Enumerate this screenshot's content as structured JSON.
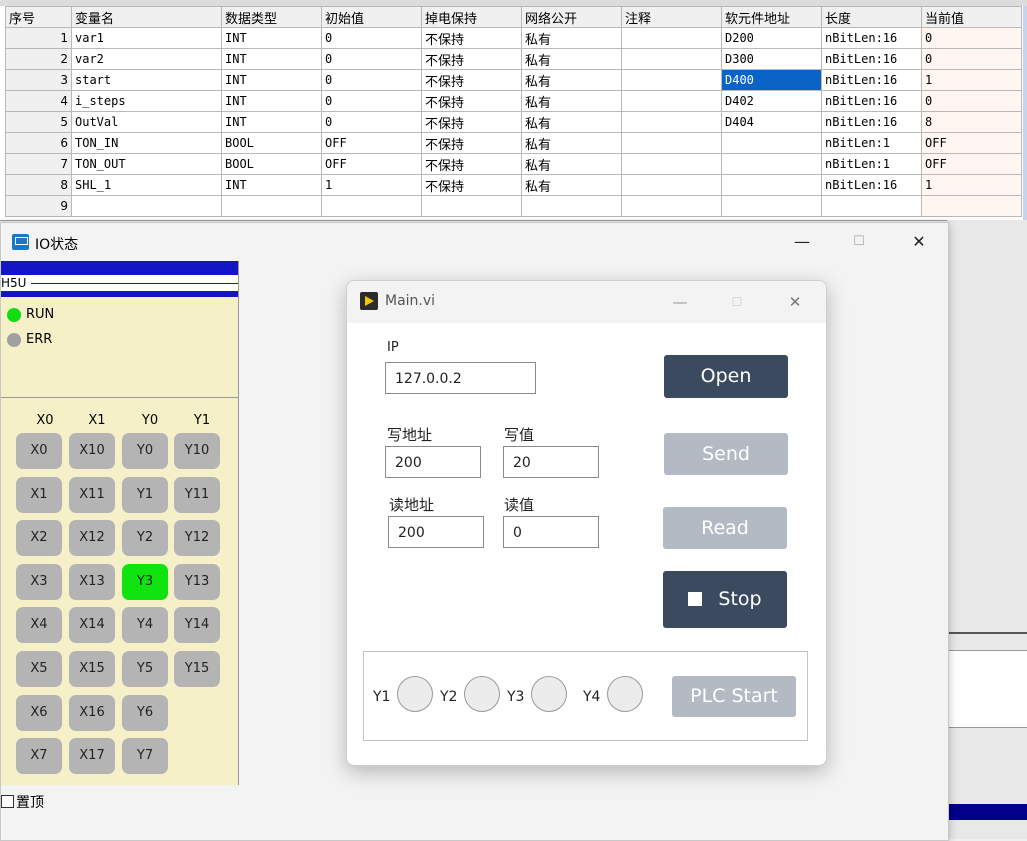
{
  "var_table": {
    "headers": [
      "序号",
      "变量名",
      "数据类型",
      "初始值",
      "掉电保持",
      "网络公开",
      "注释",
      "软元件地址",
      "长度",
      "当前值"
    ],
    "rows": [
      [
        "1",
        "var1",
        "INT",
        "0",
        "不保持",
        "私有",
        "",
        "D200",
        "nBitLen:16",
        "0"
      ],
      [
        "2",
        "var2",
        "INT",
        "0",
        "不保持",
        "私有",
        "",
        "D300",
        "nBitLen:16",
        "0"
      ],
      [
        "3",
        "start",
        "INT",
        "0",
        "不保持",
        "私有",
        "",
        "D400",
        "nBitLen:16",
        "1"
      ],
      [
        "4",
        "i_steps",
        "INT",
        "0",
        "不保持",
        "私有",
        "",
        "D402",
        "nBitLen:16",
        "0"
      ],
      [
        "5",
        "OutVal",
        "INT",
        "0",
        "不保持",
        "私有",
        "",
        "D404",
        "nBitLen:16",
        "8"
      ],
      [
        "6",
        "TON_IN",
        "BOOL",
        "OFF",
        "不保持",
        "私有",
        "",
        "",
        "nBitLen:1",
        "OFF"
      ],
      [
        "7",
        "TON_OUT",
        "BOOL",
        "OFF",
        "不保持",
        "私有",
        "",
        "",
        "nBitLen:1",
        "OFF"
      ],
      [
        "8",
        "SHL_1",
        "INT",
        "1",
        "不保持",
        "私有",
        "",
        "",
        "nBitLen:16",
        "1"
      ],
      [
        "9",
        "",
        "",
        "",
        "",
        "",
        "",
        "",
        "",
        ""
      ]
    ],
    "selected_cell": {
      "row": 3,
      "column": "软元件地址"
    }
  },
  "io_window": {
    "title": "IO状态",
    "window_buttons": {
      "minimize": "—",
      "maximize": "☐",
      "close": "✕"
    },
    "plc_model": "H5U",
    "leds": [
      {
        "label": "RUN",
        "color": "#11dd11"
      },
      {
        "label": "ERR",
        "color": "#a0a0a0"
      }
    ],
    "column_headers": [
      "X0",
      "X1",
      "Y0",
      "Y1"
    ],
    "io_buttons": [
      [
        "X0",
        "X10",
        "Y0",
        "Y10"
      ],
      [
        "X1",
        "X11",
        "Y1",
        "Y11"
      ],
      [
        "X2",
        "X12",
        "Y2",
        "Y12"
      ],
      [
        "X3",
        "X13",
        "Y3",
        "Y13"
      ],
      [
        "X4",
        "X14",
        "Y4",
        "Y14"
      ],
      [
        "X5",
        "X15",
        "Y5",
        "Y15"
      ],
      [
        "X6",
        "X16",
        "Y6",
        ""
      ],
      [
        "X7",
        "X17",
        "Y7",
        ""
      ]
    ],
    "active_outputs": [
      "Y3"
    ],
    "active_color": "#11e311",
    "topmost_label": "置顶",
    "topmost_checked": false
  },
  "main_vi": {
    "title": "Main.vi",
    "window_buttons": {
      "minimize": "—",
      "maximize": "☐",
      "close": "✕"
    },
    "ip_label": "IP",
    "ip_value": "127.0.0.2",
    "write_addr_label": "写地址",
    "write_addr_value": "200",
    "write_val_label": "写值",
    "write_val_value": "20",
    "read_addr_label": "读地址",
    "read_addr_value": "200",
    "read_val_label": "读值",
    "read_val_value": "0",
    "open_label": "Open",
    "send_label": "Send",
    "read_label": "Read",
    "stop_label": "Stop",
    "plc_start_label": "PLC Start",
    "indicators": [
      "Y1",
      "Y2",
      "Y3",
      "Y4"
    ],
    "button_color_dark": "#3b4a5e",
    "button_color_disabled": "#b3bac3"
  }
}
